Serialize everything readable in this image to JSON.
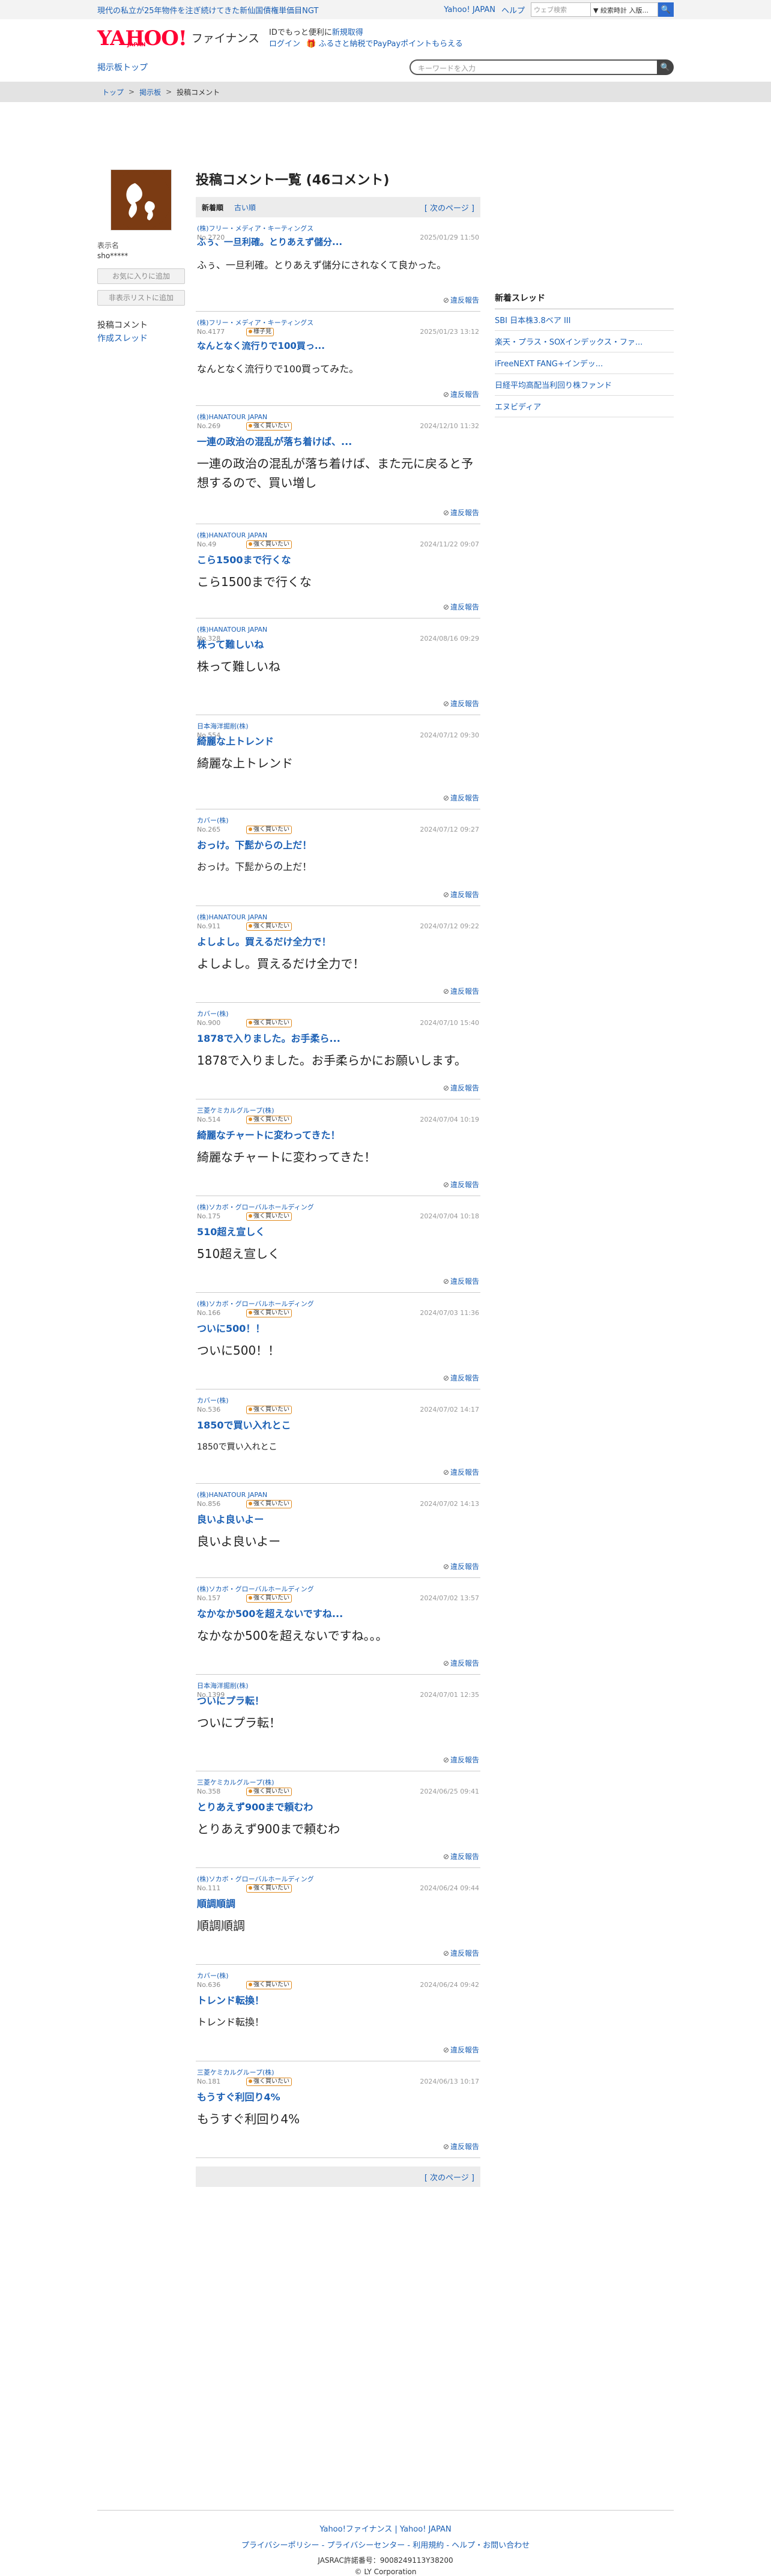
{
  "topbar": {
    "promo": "現代の私立が25年物件を注ぎ続けてきた新仙国債権単価目NGT",
    "links": [
      "Yahoo! JAPAN",
      "ヘルプ"
    ],
    "search_placeholder": "ウェブ検索",
    "search_select": "▼ 絞索時計 入版...",
    "search_btn": "🔍"
  },
  "header": {
    "logo_main": "YAHOO!",
    "logo_sub": "JAPAN",
    "service": "ファイナンス",
    "note_pre": "IDでもっと便利に",
    "note_link": "新規取得",
    "login": "ログイン",
    "paypay": "🎁 ふるさと納税でPayPayポイントもらえる"
  },
  "nav": {
    "bbs_top": "掲示板トップ",
    "search_placeholder": "キーワードを入力",
    "search_btn": "🔍"
  },
  "breadcrumb": [
    "トップ",
    "掲示板",
    "投稿コメント"
  ],
  "user": {
    "label": "表示名",
    "name": "sho*****",
    "fav_btn": "お気に入りに追加",
    "block_btn": "非表示リストに追加",
    "menu": [
      "投稿コメント",
      "作成スレッド"
    ]
  },
  "page": {
    "title": "投稿コメント一覧 (46コメント)",
    "tab_new": "新着順",
    "tab_old": "古い順",
    "next": "[ 次のページ ]"
  },
  "report_label": "違反報告",
  "posts": [
    {
      "co": "(株)フリー・メディア・キーティングス",
      "no": "No.2720",
      "date": "2025/01/29 11:50",
      "badge": "",
      "title": "ふぅ、一旦利確。とりあえず儲分...",
      "body": "ふぅ、一旦利確。とりあえず儲分にされなくて良かった。"
    },
    {
      "co": "(株)フリー・メディア・キーティングス",
      "no": "No.4177",
      "date": "2025/01/23 13:12",
      "badge": "様子見",
      "title": "なんとなく流行りで100買っ...",
      "body": "なんとなく流行りで100買ってみた。"
    },
    {
      "co": "(株)HANATOUR JAPAN",
      "no": "No.269",
      "date": "2024/12/10 11:32",
      "badge": "強く買いたい",
      "title": "一連の政治の混乱が落ち着けば、...",
      "body": "一連の政治の混乱が落ち着けば、また元に戻ると予想するので、買い増し"
    },
    {
      "co": "(株)HANATOUR JAPAN",
      "no": "No.49",
      "date": "2024/11/22 09:07",
      "badge": "強く買いたい",
      "title": "こら1500まで行くな",
      "body": "こら1500まで行くな"
    },
    {
      "co": "(株)HANATOUR JAPAN",
      "no": "No.328",
      "date": "2024/08/16 09:29",
      "badge": "",
      "title": "株って難しいね",
      "body": "株って難しいね"
    },
    {
      "co": "日本海洋掘削(株)",
      "no": "No.554",
      "date": "2024/07/12 09:30",
      "badge": "",
      "title": "綺麗な上トレンド",
      "body": "綺麗な上トレンド"
    },
    {
      "co": "カバー(株)",
      "no": "No.265",
      "date": "2024/07/12 09:27",
      "badge": "強く買いたい",
      "title": "おっけ。下髭からの上だ！",
      "body": "おっけ。下髭からの上だ！"
    },
    {
      "co": "(株)HANATOUR JAPAN",
      "no": "No.911",
      "date": "2024/07/12 09:22",
      "badge": "強く買いたい",
      "title": "よしよし。買えるだけ全力で！",
      "body": "よしよし。買えるだけ全力で！"
    },
    {
      "co": "カバー(株)",
      "no": "No.900",
      "date": "2024/07/10 15:40",
      "badge": "強く買いたい",
      "title": "1878で入りました。お手柔ら...",
      "body": "1878で入りました。お手柔らかにお願いします。"
    },
    {
      "co": "三菱ケミカルグループ(株)",
      "no": "No.514",
      "date": "2024/07/04 10:19",
      "badge": "強く買いたい",
      "title": "綺麗なチャートに変わってきた！",
      "body": "綺麗なチャートに変わってきた！"
    },
    {
      "co": "(株)ソカボ・グローバルホールディング",
      "no": "No.175",
      "date": "2024/07/04 10:18",
      "badge": "強く買いたい",
      "title": "510超え宣しく",
      "body": "510超え宣しく"
    },
    {
      "co": "(株)ソカボ・グローバルホールディング",
      "no": "No.166",
      "date": "2024/07/03 11:36",
      "badge": "強く買いたい",
      "title": "ついに500！！",
      "body": "ついに500！！"
    },
    {
      "co": "カバー(株)",
      "no": "No.536",
      "date": "2024/07/02 14:17",
      "badge": "強く買いたい",
      "title": "1850で買い入れとこ",
      "body": "1850で買い入れとこ"
    },
    {
      "co": "(株)HANATOUR JAPAN",
      "no": "No.856",
      "date": "2024/07/02 14:13",
      "badge": "強く買いたい",
      "title": "良いよ良いよー",
      "body": "良いよ良いよー"
    },
    {
      "co": "(株)ソカボ・グローバルホールディング",
      "no": "No.157",
      "date": "2024/07/02 13:57",
      "badge": "強く買いたい",
      "title": "なかなか500を超えないですね...",
      "body": "なかなか500を超えないですね。。。"
    },
    {
      "co": "日本海洋掘削(株)",
      "no": "No.1399",
      "date": "2024/07/01 12:35",
      "badge": "",
      "title": "ついにプラ転！",
      "body": "ついにプラ転！"
    },
    {
      "co": "三菱ケミカルグループ(株)",
      "no": "No.358",
      "date": "2024/06/25 09:41",
      "badge": "強く買いたい",
      "title": "とりあえず900まで頼むわ",
      "body": "とりあえず900まで頼むわ"
    },
    {
      "co": "(株)ソカボ・グローバルホールディング",
      "no": "No.111",
      "date": "2024/06/24 09:44",
      "badge": "強く買いたい",
      "title": "順調順調",
      "body": "順調順調"
    },
    {
      "co": "カバー(株)",
      "no": "No.636",
      "date": "2024/06/24 09:42",
      "badge": "強く買いたい",
      "title": "トレンド転換！",
      "body": "トレンド転換！"
    },
    {
      "co": "三菱ケミカルグループ(株)",
      "no": "No.181",
      "date": "2024/06/13 10:17",
      "badge": "強く買いたい",
      "title": "もうすぐ利回り4%",
      "body": "もうすぐ利回り4%"
    }
  ],
  "sidebar": {
    "heading": "新着スレッド",
    "items": [
      "SBI 日本株3.8ベア III",
      "楽天・プラス・SOXインデックス・ファ...",
      "iFreeNEXT FANG+インデッ...",
      "日経平均高配当利回り株ファンド",
      "エヌビディア"
    ]
  },
  "footer": {
    "r1": "Yahoo!ファイナンス  |  Yahoo! JAPAN",
    "r2": "プライバシーポリシー  -  プライバシーセンター  -  利用規約  -  ヘルプ・お問い合わせ",
    "r3": "JASRAC許諾番号：9008249113Y38200",
    "r4": "© LY Corporation"
  }
}
